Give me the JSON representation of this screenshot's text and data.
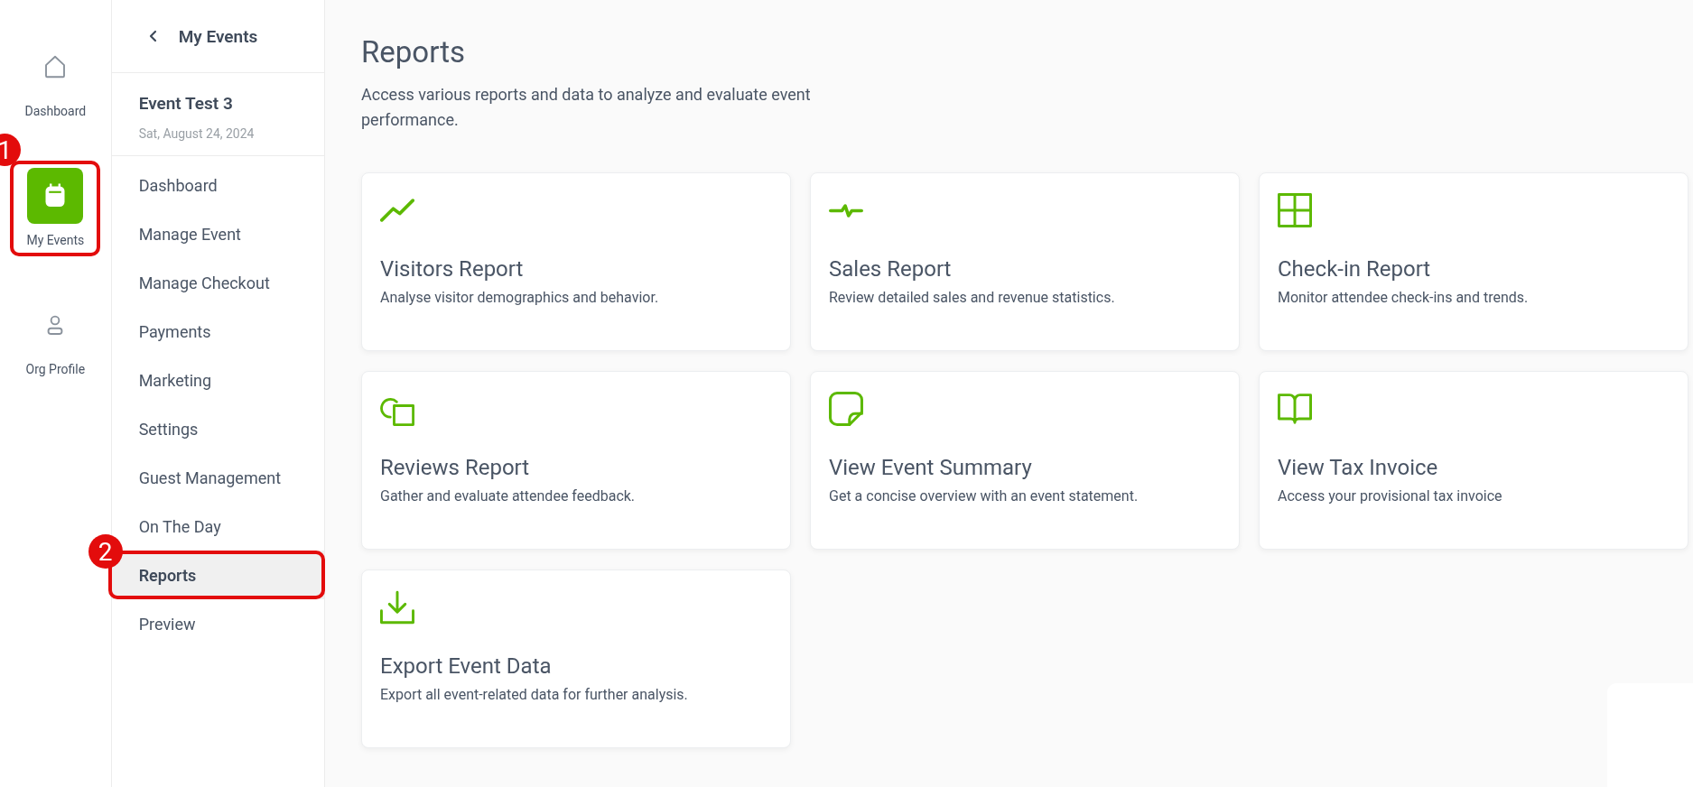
{
  "rail": [
    {
      "label": "Dashboard",
      "selected": false
    },
    {
      "label": "My Events",
      "selected": true,
      "callout": "1"
    },
    {
      "label": "Org Profile",
      "selected": false
    }
  ],
  "sidebar": {
    "back_title": "My Events",
    "event_title": "Event Test 3",
    "event_date": "Sat, August 24, 2024",
    "items": [
      {
        "label": "Dashboard",
        "selected": false
      },
      {
        "label": "Manage Event",
        "selected": false
      },
      {
        "label": "Manage Checkout",
        "selected": false
      },
      {
        "label": "Payments",
        "selected": false
      },
      {
        "label": "Marketing",
        "selected": false
      },
      {
        "label": "Settings",
        "selected": false
      },
      {
        "label": "Guest Management",
        "selected": false
      },
      {
        "label": "On The Day",
        "selected": false
      },
      {
        "label": "Reports",
        "selected": true,
        "callout": "2"
      },
      {
        "label": "Preview",
        "selected": false
      }
    ]
  },
  "page": {
    "title": "Reports",
    "subtitle": "Access various reports and data to analyze and evaluate event performance."
  },
  "cards": [
    {
      "title": "Visitors Report",
      "description": "Analyse visitor demographics and behavior."
    },
    {
      "title": "Sales Report",
      "description": "Review detailed sales and revenue statistics."
    },
    {
      "title": "Check-in Report",
      "description": "Monitor attendee check-ins and trends."
    },
    {
      "title": "Reviews Report",
      "description": "Gather and evaluate attendee feedback."
    },
    {
      "title": "View Event Summary",
      "description": "Get a concise overview with an event statement."
    },
    {
      "title": "View Tax Invoice",
      "description": "Access your provisional tax invoice"
    },
    {
      "title": "Export Event Data",
      "description": "Export all event-related data for further analysis."
    }
  ]
}
